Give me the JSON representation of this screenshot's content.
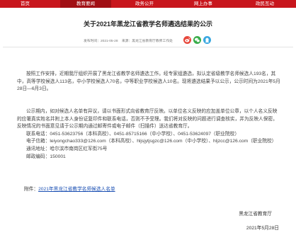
{
  "nav": {
    "items": [
      {
        "label": "首页",
        "active": false
      },
      {
        "label": "教育要闻",
        "active": true
      },
      {
        "label": "政务公开",
        "active": false
      },
      {
        "label": "网上办事",
        "active": false
      },
      {
        "label": "政民互动",
        "active": false
      }
    ]
  },
  "article": {
    "title": "关于2021年黑龙江省教学名师遴选结果的公示",
    "meta": {
      "date_label": "发布时间：2021-05-28",
      "source_label": "来源：黑龙江省教育厅教师工作处"
    },
    "share_icons": [
      "weibo-icon",
      "wechat-icon",
      "qq-icon"
    ],
    "paragraph1": "按照工作安排，近期我厅组织开展了黑龙江省教学名师遴选工作。经专家组遴选，拟认定省级教学名师候选人193名，其中，高等学校候选人113名，中小学校候选人70名，中等职业学校候选人10名。现将遴选结果予以公示，公示时间为2021年5月28日—6月3日。",
    "paragraph2": "公示期内，如对候选人名单有异议，请以书面形式向省教育厅反映。以单位名义反映的应加盖单位公章，以个人名义反映的应署真实姓名并附上本人身份证复印件和联系电话，否则不予受理。我们将对反映的问题进行调查核实，并为反映人保密。反映情况的书面意见请于公示期内通过邮寄件或电子邮件（扫描件）送达省教育厅。",
    "contact": {
      "phone": "联系电话：0451-53623756（本科高校）、0451-85715166（中小学校）、0451-53624097（职业院校）",
      "email": "电子信箱：leiyongchao333@126.com（本科高校）、hljsjytjsgzc@126.com（中小学校）、hljzcc@126.com（职业院校）",
      "address": "通讯地址：哈尔滨市南岗区红军街75号",
      "postcode": "邮政编码：150001"
    },
    "attachment_prefix": "附件：",
    "attachment_link": "2021年黑龙江省教学名师候选人名单",
    "sign_org": "黑龙江省教育厅",
    "sign_date": "2021年5月28日"
  },
  "colors": {
    "nav_bg": "#c8161d",
    "nav_active": "#a10f14",
    "link": "#1a4fb3"
  }
}
